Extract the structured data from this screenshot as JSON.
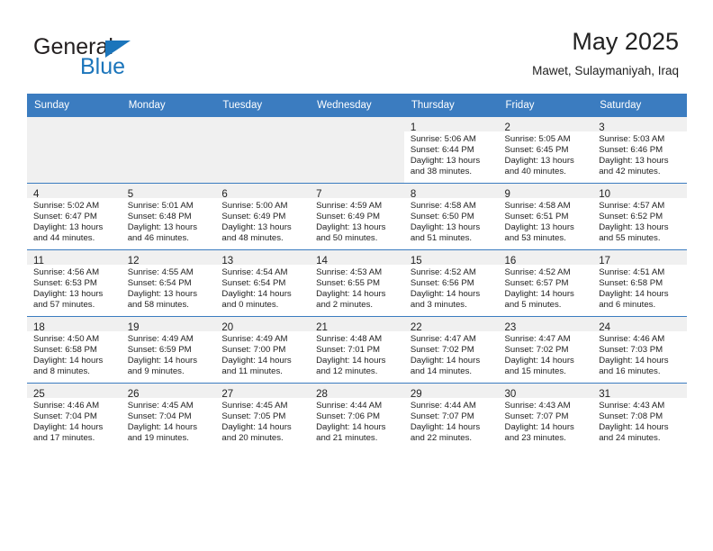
{
  "brand": {
    "name_part1": "General",
    "name_part2": "Blue",
    "accent_color": "#1b75bb"
  },
  "header": {
    "title": "May 2025",
    "subtitle": "Mawet, Sulaymaniyah, Iraq"
  },
  "theme": {
    "header_bg": "#3b7cc0",
    "shaded_cell": "#f0f0f0",
    "text": "#222222"
  },
  "weekday_headers": [
    "Sunday",
    "Monday",
    "Tuesday",
    "Wednesday",
    "Thursday",
    "Friday",
    "Saturday"
  ],
  "weeks": [
    [
      {
        "empty": true
      },
      {
        "empty": true
      },
      {
        "empty": true
      },
      {
        "empty": true
      },
      {
        "day": "1",
        "sunrise": "Sunrise: 5:06 AM",
        "sunset": "Sunset: 6:44 PM",
        "daylight1": "Daylight: 13 hours",
        "daylight2": "and 38 minutes."
      },
      {
        "day": "2",
        "sunrise": "Sunrise: 5:05 AM",
        "sunset": "Sunset: 6:45 PM",
        "daylight1": "Daylight: 13 hours",
        "daylight2": "and 40 minutes."
      },
      {
        "day": "3",
        "sunrise": "Sunrise: 5:03 AM",
        "sunset": "Sunset: 6:46 PM",
        "daylight1": "Daylight: 13 hours",
        "daylight2": "and 42 minutes."
      }
    ],
    [
      {
        "day": "4",
        "sunrise": "Sunrise: 5:02 AM",
        "sunset": "Sunset: 6:47 PM",
        "daylight1": "Daylight: 13 hours",
        "daylight2": "and 44 minutes."
      },
      {
        "day": "5",
        "sunrise": "Sunrise: 5:01 AM",
        "sunset": "Sunset: 6:48 PM",
        "daylight1": "Daylight: 13 hours",
        "daylight2": "and 46 minutes."
      },
      {
        "day": "6",
        "sunrise": "Sunrise: 5:00 AM",
        "sunset": "Sunset: 6:49 PM",
        "daylight1": "Daylight: 13 hours",
        "daylight2": "and 48 minutes."
      },
      {
        "day": "7",
        "sunrise": "Sunrise: 4:59 AM",
        "sunset": "Sunset: 6:49 PM",
        "daylight1": "Daylight: 13 hours",
        "daylight2": "and 50 minutes."
      },
      {
        "day": "8",
        "sunrise": "Sunrise: 4:58 AM",
        "sunset": "Sunset: 6:50 PM",
        "daylight1": "Daylight: 13 hours",
        "daylight2": "and 51 minutes."
      },
      {
        "day": "9",
        "sunrise": "Sunrise: 4:58 AM",
        "sunset": "Sunset: 6:51 PM",
        "daylight1": "Daylight: 13 hours",
        "daylight2": "and 53 minutes."
      },
      {
        "day": "10",
        "sunrise": "Sunrise: 4:57 AM",
        "sunset": "Sunset: 6:52 PM",
        "daylight1": "Daylight: 13 hours",
        "daylight2": "and 55 minutes."
      }
    ],
    [
      {
        "day": "11",
        "sunrise": "Sunrise: 4:56 AM",
        "sunset": "Sunset: 6:53 PM",
        "daylight1": "Daylight: 13 hours",
        "daylight2": "and 57 minutes."
      },
      {
        "day": "12",
        "sunrise": "Sunrise: 4:55 AM",
        "sunset": "Sunset: 6:54 PM",
        "daylight1": "Daylight: 13 hours",
        "daylight2": "and 58 minutes."
      },
      {
        "day": "13",
        "sunrise": "Sunrise: 4:54 AM",
        "sunset": "Sunset: 6:54 PM",
        "daylight1": "Daylight: 14 hours",
        "daylight2": "and 0 minutes."
      },
      {
        "day": "14",
        "sunrise": "Sunrise: 4:53 AM",
        "sunset": "Sunset: 6:55 PM",
        "daylight1": "Daylight: 14 hours",
        "daylight2": "and 2 minutes."
      },
      {
        "day": "15",
        "sunrise": "Sunrise: 4:52 AM",
        "sunset": "Sunset: 6:56 PM",
        "daylight1": "Daylight: 14 hours",
        "daylight2": "and 3 minutes."
      },
      {
        "day": "16",
        "sunrise": "Sunrise: 4:52 AM",
        "sunset": "Sunset: 6:57 PM",
        "daylight1": "Daylight: 14 hours",
        "daylight2": "and 5 minutes."
      },
      {
        "day": "17",
        "sunrise": "Sunrise: 4:51 AM",
        "sunset": "Sunset: 6:58 PM",
        "daylight1": "Daylight: 14 hours",
        "daylight2": "and 6 minutes."
      }
    ],
    [
      {
        "day": "18",
        "sunrise": "Sunrise: 4:50 AM",
        "sunset": "Sunset: 6:58 PM",
        "daylight1": "Daylight: 14 hours",
        "daylight2": "and 8 minutes."
      },
      {
        "day": "19",
        "sunrise": "Sunrise: 4:49 AM",
        "sunset": "Sunset: 6:59 PM",
        "daylight1": "Daylight: 14 hours",
        "daylight2": "and 9 minutes."
      },
      {
        "day": "20",
        "sunrise": "Sunrise: 4:49 AM",
        "sunset": "Sunset: 7:00 PM",
        "daylight1": "Daylight: 14 hours",
        "daylight2": "and 11 minutes."
      },
      {
        "day": "21",
        "sunrise": "Sunrise: 4:48 AM",
        "sunset": "Sunset: 7:01 PM",
        "daylight1": "Daylight: 14 hours",
        "daylight2": "and 12 minutes."
      },
      {
        "day": "22",
        "sunrise": "Sunrise: 4:47 AM",
        "sunset": "Sunset: 7:02 PM",
        "daylight1": "Daylight: 14 hours",
        "daylight2": "and 14 minutes."
      },
      {
        "day": "23",
        "sunrise": "Sunrise: 4:47 AM",
        "sunset": "Sunset: 7:02 PM",
        "daylight1": "Daylight: 14 hours",
        "daylight2": "and 15 minutes."
      },
      {
        "day": "24",
        "sunrise": "Sunrise: 4:46 AM",
        "sunset": "Sunset: 7:03 PM",
        "daylight1": "Daylight: 14 hours",
        "daylight2": "and 16 minutes."
      }
    ],
    [
      {
        "day": "25",
        "sunrise": "Sunrise: 4:46 AM",
        "sunset": "Sunset: 7:04 PM",
        "daylight1": "Daylight: 14 hours",
        "daylight2": "and 17 minutes."
      },
      {
        "day": "26",
        "sunrise": "Sunrise: 4:45 AM",
        "sunset": "Sunset: 7:04 PM",
        "daylight1": "Daylight: 14 hours",
        "daylight2": "and 19 minutes."
      },
      {
        "day": "27",
        "sunrise": "Sunrise: 4:45 AM",
        "sunset": "Sunset: 7:05 PM",
        "daylight1": "Daylight: 14 hours",
        "daylight2": "and 20 minutes."
      },
      {
        "day": "28",
        "sunrise": "Sunrise: 4:44 AM",
        "sunset": "Sunset: 7:06 PM",
        "daylight1": "Daylight: 14 hours",
        "daylight2": "and 21 minutes."
      },
      {
        "day": "29",
        "sunrise": "Sunrise: 4:44 AM",
        "sunset": "Sunset: 7:07 PM",
        "daylight1": "Daylight: 14 hours",
        "daylight2": "and 22 minutes."
      },
      {
        "day": "30",
        "sunrise": "Sunrise: 4:43 AM",
        "sunset": "Sunset: 7:07 PM",
        "daylight1": "Daylight: 14 hours",
        "daylight2": "and 23 minutes."
      },
      {
        "day": "31",
        "sunrise": "Sunrise: 4:43 AM",
        "sunset": "Sunset: 7:08 PM",
        "daylight1": "Daylight: 14 hours",
        "daylight2": "and 24 minutes."
      }
    ]
  ]
}
